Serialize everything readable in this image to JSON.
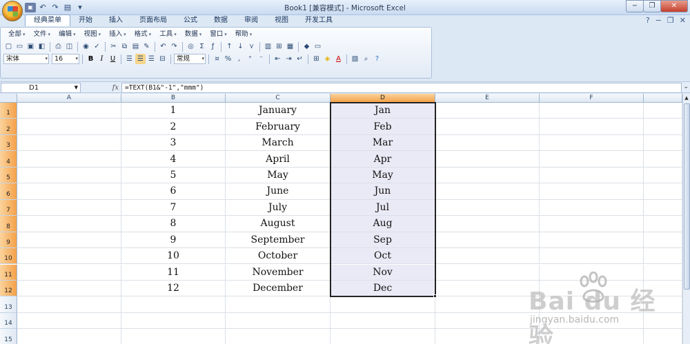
{
  "window": {
    "title": "Book1  [兼容模式] - Microsoft Excel",
    "controls": [
      "−",
      "❐",
      "✕"
    ]
  },
  "ribbon_tabs": [
    "经典菜单",
    "开始",
    "插入",
    "页面布局",
    "公式",
    "数据",
    "审阅",
    "视图",
    "开发工具"
  ],
  "classic_menu": [
    "全部",
    "文件",
    "编辑",
    "视图",
    "插入",
    "格式",
    "工具",
    "数据",
    "窗口",
    "帮助"
  ],
  "toolbar": {
    "font_name": "宋体",
    "font_size": "16",
    "bold": "B",
    "italic": "I",
    "underline": "U",
    "number_format": "常规",
    "percent": "%",
    "comma": ","
  },
  "formula_bar": {
    "name_box": "D1",
    "fx": "fx",
    "formula": "=TEXT(B1&\"-1\",\"mmm\")"
  },
  "columns": [
    "A",
    "B",
    "C",
    "D",
    "E",
    "F"
  ],
  "selected_column": "D",
  "rows": [
    "1",
    "2",
    "3",
    "4",
    "5",
    "6",
    "7",
    "8",
    "9",
    "10",
    "11",
    "12",
    "13",
    "14",
    "15"
  ],
  "table": [
    {
      "b": "1",
      "c": "January",
      "d": "Jan"
    },
    {
      "b": "2",
      "c": "February",
      "d": "Feb"
    },
    {
      "b": "3",
      "c": "March",
      "d": "Mar"
    },
    {
      "b": "4",
      "c": "April",
      "d": "Apr"
    },
    {
      "b": "5",
      "c": "May",
      "d": "May"
    },
    {
      "b": "6",
      "c": "June",
      "d": "Jun"
    },
    {
      "b": "7",
      "c": "July",
      "d": "Jul"
    },
    {
      "b": "8",
      "c": "August",
      "d": "Aug"
    },
    {
      "b": "9",
      "c": "September",
      "d": "Sep"
    },
    {
      "b": "10",
      "c": "October",
      "d": "Oct"
    },
    {
      "b": "11",
      "c": "November",
      "d": "Nov"
    },
    {
      "b": "12",
      "c": "December",
      "d": "Dec"
    }
  ],
  "watermark": {
    "text": "Bai du 经验",
    "url": "jingyan.baidu.com"
  },
  "colors": {
    "selected_header": "#f4a14a",
    "selection_fill": "#eaeaf6"
  }
}
